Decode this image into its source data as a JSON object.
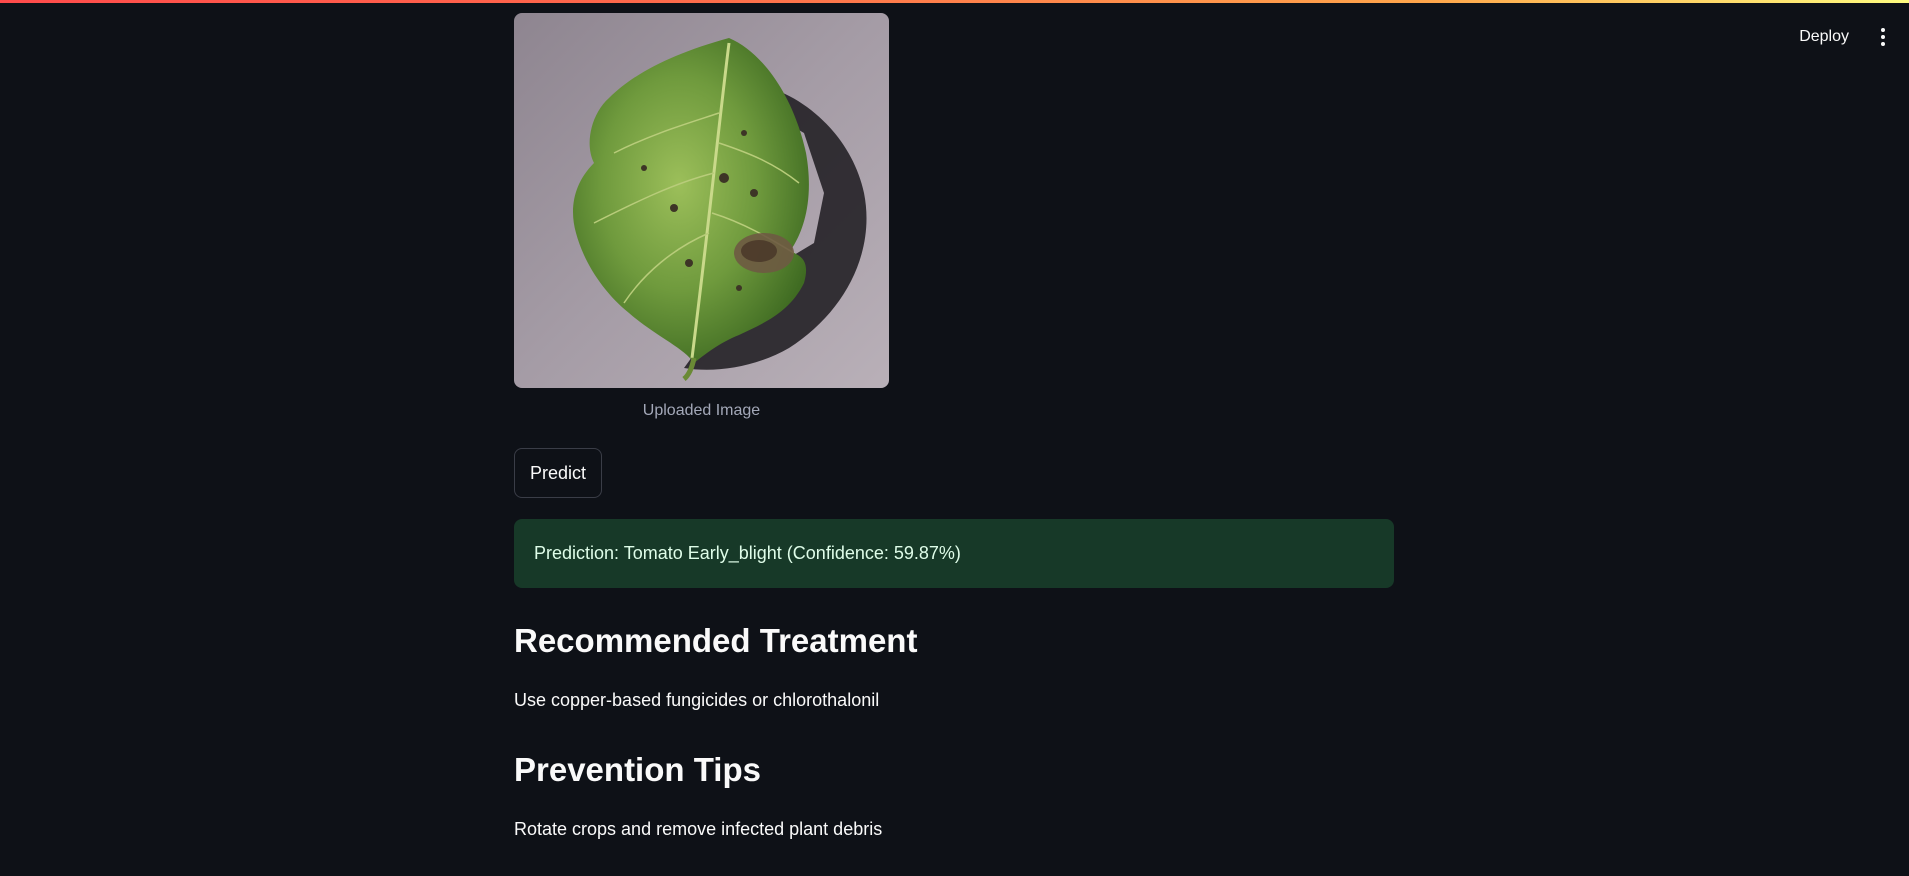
{
  "header": {
    "deploy_label": "Deploy",
    "menu_icon": "more-vertical-icon"
  },
  "image": {
    "caption": "Uploaded Image"
  },
  "actions": {
    "predict_label": "Predict"
  },
  "result": {
    "prediction_text": "Prediction: Tomato Early_blight (Confidence: 59.87%)"
  },
  "sections": {
    "treatment_title": "Recommended Treatment",
    "treatment_text": "Use copper-based fungicides or chlorothalonil",
    "prevention_title": "Prevention Tips",
    "prevention_text": "Rotate crops and remove infected plant debris"
  },
  "colors": {
    "background": "#0e1117",
    "success_bg": "#173928",
    "success_text": "#dffde9",
    "accent_gradient_start": "#ff4b4b",
    "accent_gradient_end": "#fffd80"
  }
}
